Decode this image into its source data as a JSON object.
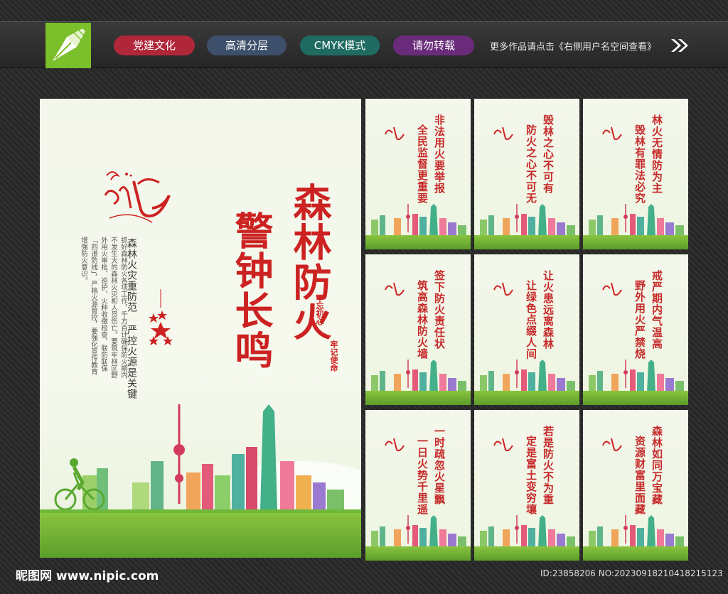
{
  "header": {
    "tags": [
      "党建文化",
      "高清分层",
      "CMYK模式",
      "请勿转载"
    ],
    "more_text": "更多作品请点击《右侧用户名空间查看》"
  },
  "main_poster": {
    "title_line1": "森林防火",
    "title_line2": "警钟长鸣",
    "subtitle": "森林火灾重防范 严控火源是关键",
    "body": "抓好森林防火各项工作，千方百计确保防火期内不发生大的森林火灾和人员伤亡。要筑牢林区野外用火审批、巡护、火种收缴检查、联防联保「四道防线」，严格火源管控，要强化宣传教育增强防火意识。",
    "side_text_1": "不忘初心",
    "side_text_2": "牢记使命"
  },
  "small_posters": [
    {
      "line1": "非法用火要举报",
      "line2": "全民监督更重要"
    },
    {
      "line1": "毁林之心不可有",
      "line2": "防火之心不可无"
    },
    {
      "line1": "林火无情防为主",
      "line2": "毁林有罪法必究"
    },
    {
      "line1": "签下防火责任状",
      "line2": "筑高森林防火墙"
    },
    {
      "line1": "让火患远离森林",
      "line2": "让绿色点缀人间"
    },
    {
      "line1": "戒严期内气温高",
      "line2": "野外用火严禁烧"
    },
    {
      "line1": "一时疏忽火星飘",
      "line2": "一日火势千里遥"
    },
    {
      "line1": "若是防火不为重",
      "line2": "定是富土变穷壤"
    },
    {
      "line1": "森林如同万宝藏",
      "line2": "资源财富里面藏"
    }
  ],
  "footer": {
    "site": "昵图网 www.nipic.com",
    "id_text": "ID:23858206 NO:20230918210418215123"
  },
  "colors": {
    "title_red": "#c22222",
    "grass_green": "#7bbf2a"
  }
}
